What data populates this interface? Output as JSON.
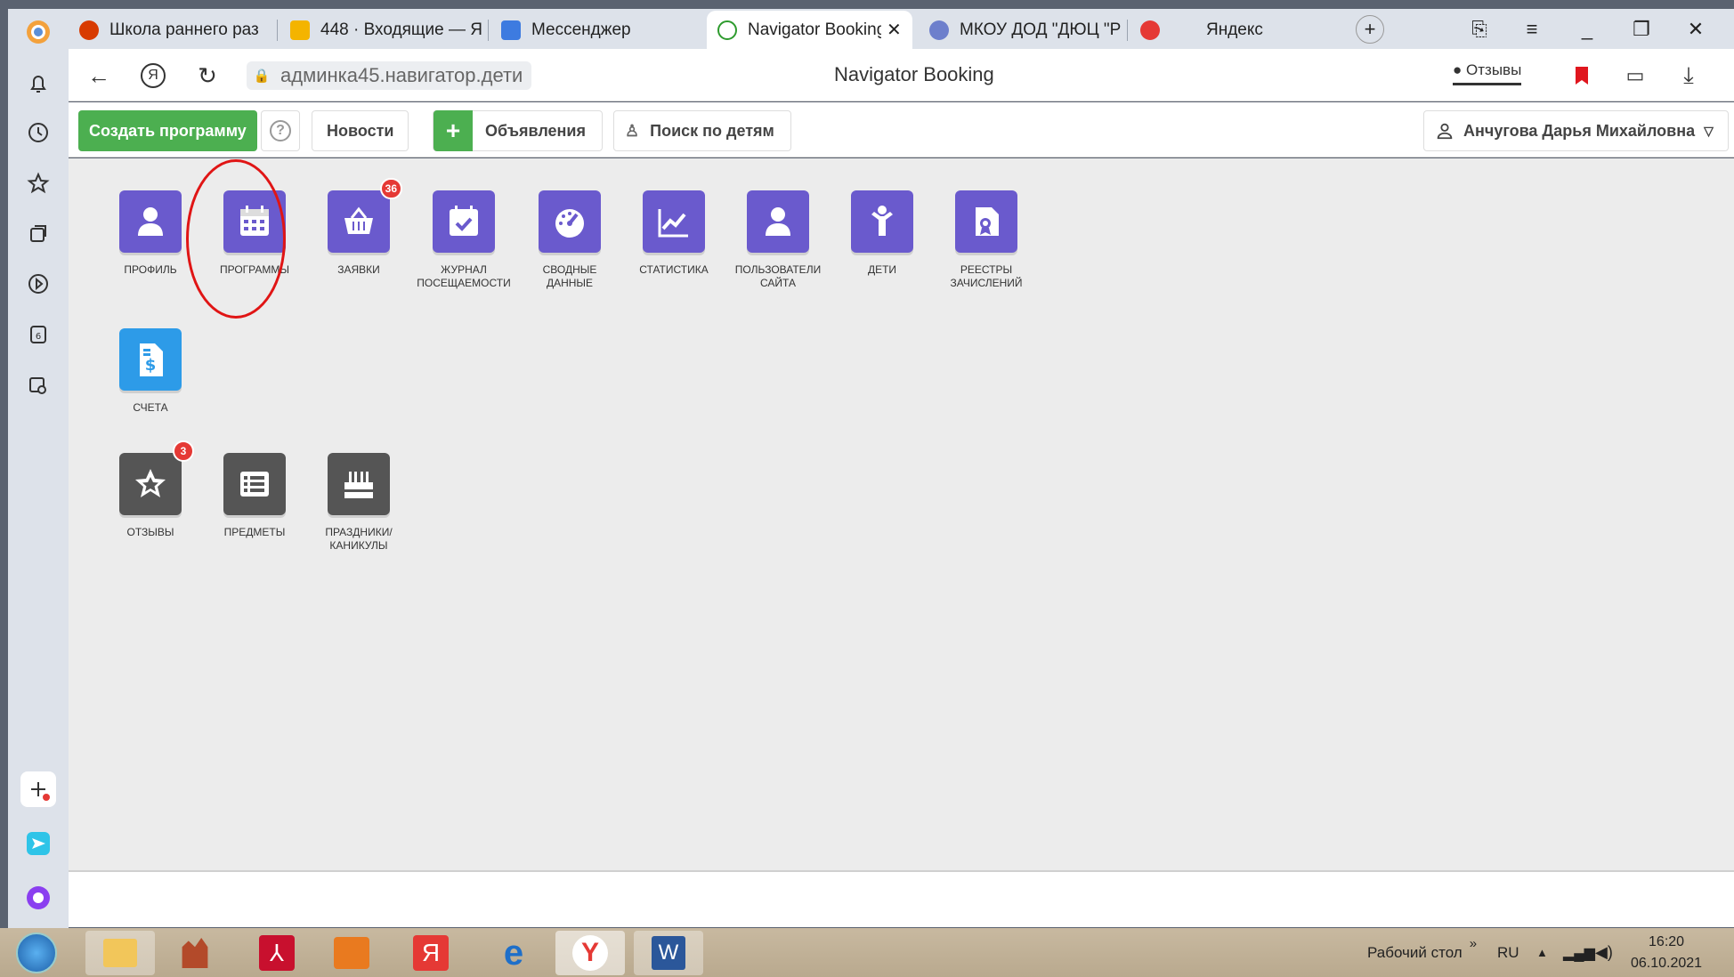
{
  "browser": {
    "tabs": [
      {
        "label": "Школа раннего раз",
        "color": "#d83b01"
      },
      {
        "label": "448 · Входящие — Я",
        "color": "#f4b400"
      },
      {
        "label": "Мессенджер",
        "color": "#3d7be0"
      },
      {
        "label": "Navigator Booking",
        "color": "#2e9b2e"
      },
      {
        "label": "МКОУ ДОД \"ДЮЦ \"Р",
        "color": "#6d7fcc"
      },
      {
        "label": "Яндекс",
        "color": "#e53935"
      }
    ],
    "url_host": "админка45.навигатор.дети",
    "page_title": "Navigator Booking",
    "reviews_label": "Отзывы"
  },
  "toolbar": {
    "create_label": "Создать программу",
    "help_glyph": "?",
    "news_label": "Новости",
    "ads_plus": "+",
    "ads_label": "Объявления",
    "kids_search_label": "Поиск по детям",
    "user_name": "Анчугова Дарья Михайловна"
  },
  "tiles_row1": [
    {
      "label": "ПРОФИЛЬ",
      "icon": "user-icon"
    },
    {
      "label": "ПРОГРАММЫ",
      "icon": "calendar-icon"
    },
    {
      "label": "ЗАЯВКИ",
      "icon": "basket-icon",
      "badge": "36"
    },
    {
      "label": "ЖУРНАЛ ПОСЕЩАЕМОСТИ",
      "icon": "calendar-check-icon"
    },
    {
      "label": "СВОДНЫЕ ДАННЫЕ",
      "icon": "gauge-icon"
    },
    {
      "label": "СТАТИСТИКА",
      "icon": "chart-icon"
    },
    {
      "label": "ПОЛЬЗОВАТЕЛИ САЙТА",
      "icon": "user-icon"
    },
    {
      "label": "ДЕТИ",
      "icon": "child-icon"
    },
    {
      "label": "РЕЕСТРЫ ЗАЧИСЛЕНИЙ",
      "icon": "certificate-icon"
    }
  ],
  "tiles_row2": [
    {
      "label": "СЧЕТА",
      "icon": "invoice-icon"
    }
  ],
  "tiles_row3": [
    {
      "label": "ОТЗЫВЫ",
      "icon": "star-icon",
      "badge": "3"
    },
    {
      "label": "ПРЕДМЕТЫ",
      "icon": "list-icon"
    },
    {
      "label": "ПРАЗДНИКИ/ КАНИКУЛЫ",
      "icon": "cake-icon"
    }
  ],
  "taskbar": {
    "desktop_label": "Рабочий стол",
    "lang": "RU",
    "time": "16:20",
    "date": "06.10.2021"
  },
  "colors": {
    "accent_green": "#4caf50",
    "tile_purple": "#6a5acd",
    "tile_blue": "#2d9be8",
    "tile_gray": "#555555",
    "badge_red": "#e53935",
    "annotation_red": "#e01515"
  }
}
